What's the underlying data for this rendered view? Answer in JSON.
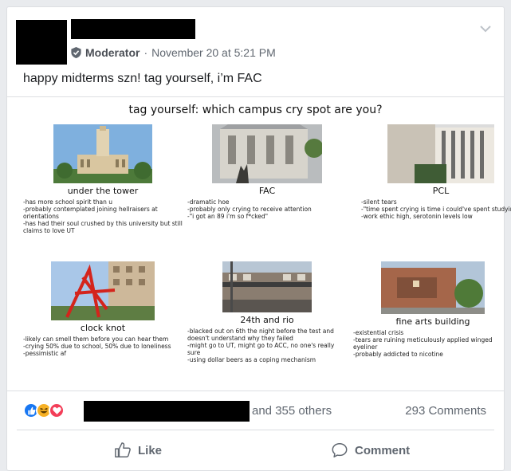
{
  "post": {
    "role": "Moderator",
    "timestamp": "November 20 at 5:21 PM",
    "text": "happy midterms szn! tag yourself, i’m FAC"
  },
  "meme": {
    "title": "tag yourself: which campus cry spot are you?",
    "cells": [
      {
        "label": "under the tower",
        "desc": "-has more school spirit than u\n-probably contemplated joining hellraisers at orientations\n-has had their soul crushed by this university but still claims to love UT"
      },
      {
        "label": "FAC",
        "desc": "-dramatic hoe\n-probably only crying to receive attention\n-\"i got an 89 i'm so f*cked\""
      },
      {
        "label": "PCL",
        "desc": "-silent tears\n-\"time spent crying is time i could've spent studying\"\n-work ethic high, serotonin levels low"
      },
      {
        "label": "clock knot",
        "desc": "-likely can smell them before you can hear them\n-crying 50% due to school, 50% due to loneliness\n-pessimistic af"
      },
      {
        "label": "24th and rio",
        "desc": "-blacked out on 6th the night before the test and doesn't understand why they failed\n-might go to UT, might go to ACC, no one's really sure\n-using dollar beers as a coping mechanism"
      },
      {
        "label": "fine arts building",
        "desc": "-existential crisis\n-tears are ruining meticulously applied winged eyeliner\n-probably addicted to nicotine"
      }
    ]
  },
  "footer": {
    "others": "and 355 others",
    "comments": "293 Comments",
    "like_label": "Like",
    "comment_label": "Comment"
  },
  "colors": {
    "like_blue": "#1877f2",
    "haha_yellow": "#f7b125",
    "love_red": "#f33e58",
    "text_gray": "#606770"
  }
}
